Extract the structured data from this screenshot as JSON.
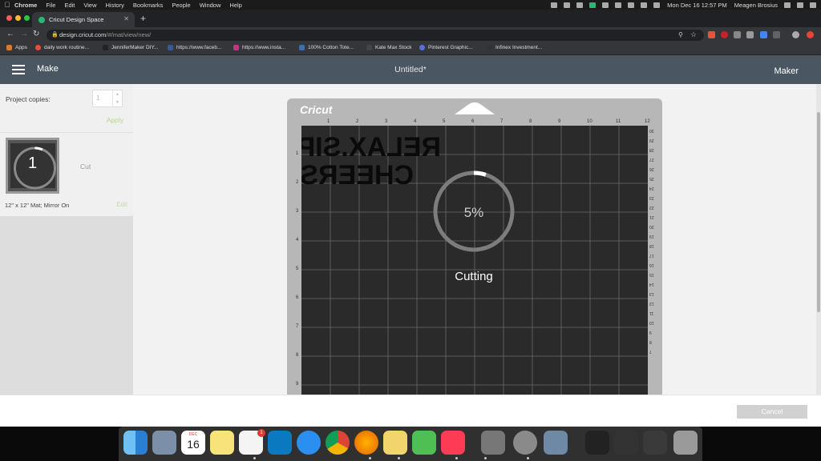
{
  "menubar": {
    "items": [
      "Chrome",
      "File",
      "Edit",
      "View",
      "History",
      "Bookmarks",
      "People",
      "Window",
      "Help"
    ],
    "clock": "Mon Dec 16  12:57 PM",
    "user": "Meagen Brosius"
  },
  "browser": {
    "tab_title": "Cricut Design Space",
    "url_host": "design.cricut.com",
    "url_path": "/#/mat/view/new/"
  },
  "bookmarks": [
    {
      "label": "Apps",
      "color": "#d67c2c"
    },
    {
      "label": "daily work routine...",
      "color": "#e74c3c"
    },
    {
      "label": "JenniferMaker DIY...",
      "color": "#222222"
    },
    {
      "label": "https://www.faceb...",
      "color": "#3b5998"
    },
    {
      "label": "https://www.insta...",
      "color": "#c13584"
    },
    {
      "label": "100% Cotton Tote...",
      "color": "#3a6fb0"
    },
    {
      "label": "Kate Max Stock",
      "color": "#444444"
    },
    {
      "label": "Pinterest Graphic...",
      "color": "#5a6fd8"
    },
    {
      "label": "Infinex Investment...",
      "color": "#333333"
    }
  ],
  "app": {
    "mode": "Make",
    "project_title": "Untitled*",
    "machine": "Maker"
  },
  "panel": {
    "copies_label": "Project copies:",
    "copies_value": "1",
    "apply_label": "Apply",
    "mat_number": "1",
    "mat_status": "Cut",
    "mat_desc": "12\" x 12\" Mat; Mirror On",
    "edit_label": "Edit"
  },
  "mat": {
    "brand": "Cricut",
    "top_ruler": [
      "1",
      "2",
      "3",
      "4",
      "5",
      "6",
      "7",
      "8",
      "9",
      "10",
      "11",
      "12"
    ],
    "left_ruler": [
      "1",
      "2",
      "3",
      "4",
      "5",
      "6",
      "7",
      "8",
      "9"
    ],
    "right_ruler": [
      "30",
      "29",
      "28",
      "27",
      "26",
      "25",
      "24",
      "23",
      "22",
      "21",
      "20",
      "19",
      "18",
      "17",
      "16",
      "15",
      "14",
      "13",
      "12",
      "11",
      "10",
      "9",
      "8",
      "7"
    ],
    "design_line1": "RELAX.SIP.",
    "design_line2": "CHEERS."
  },
  "progress": {
    "percent_text": "5%",
    "percent": 5,
    "status": "Cutting"
  },
  "footer": {
    "cancel_label": "Cancel"
  },
  "dock": {
    "calendar_month": "DEC",
    "calendar_day": "16",
    "slack_badge": "1"
  },
  "colors": {
    "header": "#4a5662",
    "accent_green": "#b9d68e",
    "mat_grid": "#2a2a2a"
  }
}
